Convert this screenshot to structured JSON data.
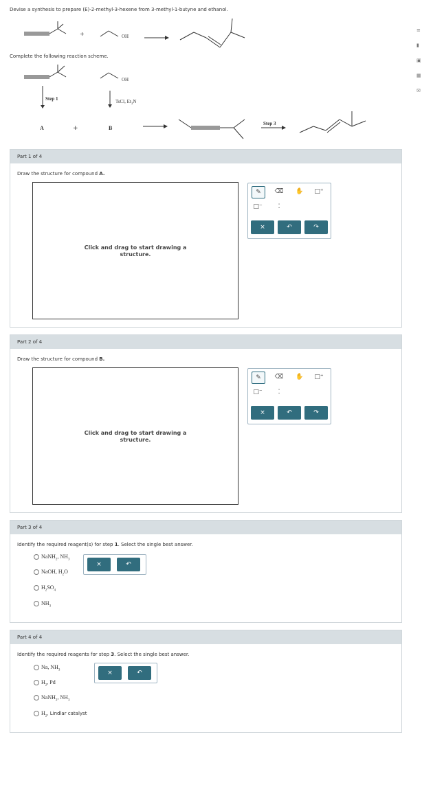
{
  "prompt": {
    "full": "Devise a synthesis to prepare (E)-2-methyl-3-hexene from 3-methyl-1-butyne and ethanol."
  },
  "scheme_top": {
    "plus": "+",
    "oh_label": "OH"
  },
  "complete_text": "Complete the following reaction scheme.",
  "scheme": {
    "oh_label": "OH",
    "step1_label": "Step 1",
    "reagent_b": "TsCl, Et",
    "reagent_b_sub": "3",
    "reagent_b_n": "N",
    "label_a": "A",
    "plus": "+",
    "label_b": "B",
    "step3_label": "Step 3"
  },
  "parts": [
    {
      "header": "Part 1 of 4",
      "question_prefix": "Draw the structure for compound ",
      "question_bold": "A.",
      "canvas_msg_1": "Click and drag to start drawing a",
      "canvas_msg_2": "structure."
    },
    {
      "header": "Part 2 of 4",
      "question_prefix": "Draw the structure for compound ",
      "question_bold": "B.",
      "canvas_msg_1": "Click and drag to start drawing a",
      "canvas_msg_2": "structure."
    },
    {
      "header": "Part 3 of 4",
      "question_prefix": "Identify the required reagent(s) for step ",
      "question_bold": "1",
      "question_suffix": ". Select the single best answer.",
      "options": [
        {
          "main": "NaNH",
          "sub": "2",
          "tail": ", NH",
          "sub2": "3"
        },
        {
          "main": "NaOH, H",
          "sub": "2",
          "tail": "O",
          "sub2": ""
        },
        {
          "main": "H",
          "sub": "2",
          "tail": "SO",
          "sub2": "4"
        },
        {
          "main": "NH",
          "sub": "3",
          "tail": "",
          "sub2": ""
        }
      ]
    },
    {
      "header": "Part 4 of 4",
      "question_prefix": "Identify the required reagents for step ",
      "question_bold": "3",
      "question_suffix": ". Select the single best answer.",
      "options": [
        {
          "main": "Na, NH",
          "sub": "3",
          "tail": "",
          "sub2": ""
        },
        {
          "main": "H",
          "sub": "2",
          "tail": ", Pd",
          "sub2": ""
        },
        {
          "main": "NaNH",
          "sub": "2",
          "tail": ", NH",
          "sub2": "3"
        },
        {
          "main": "H",
          "sub": "2",
          "tail": ", Lindlar catalyst",
          "sub2": ""
        }
      ]
    }
  ],
  "buttons": {
    "clear": "×",
    "undo": "↶",
    "redo": "↷"
  },
  "icons": {
    "pencil": "pencil-icon",
    "eraser": "eraser-icon",
    "hand": "hand-icon",
    "charge": "charge-icon",
    "ring": "ring-template-icon",
    "lonepair": "lone-pair-icon"
  }
}
